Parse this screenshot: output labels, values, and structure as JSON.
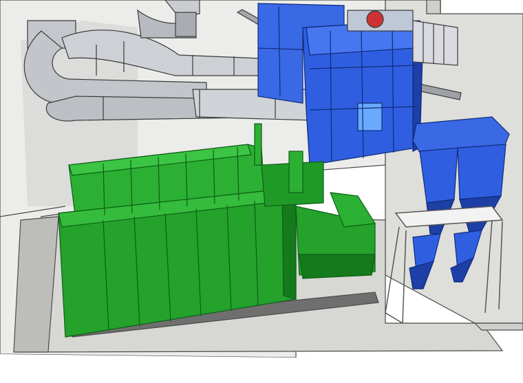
{
  "scene": {
    "description_visible_text": "",
    "colors": {
      "background": "#ffffff",
      "wall": "#e6e6e4",
      "wall_shadow": "#cfcfcc",
      "floor": "#d9d9d6",
      "duct": "#b9bcc2",
      "duct_light": "#d8dade",
      "blue_unit": "#2f5fe0",
      "blue_dark": "#1d3fa6",
      "green_unit": "#22a02a",
      "green_dark": "#157a1c",
      "beam": "#9a9ea3",
      "outline": "#3a3a3a"
    }
  }
}
